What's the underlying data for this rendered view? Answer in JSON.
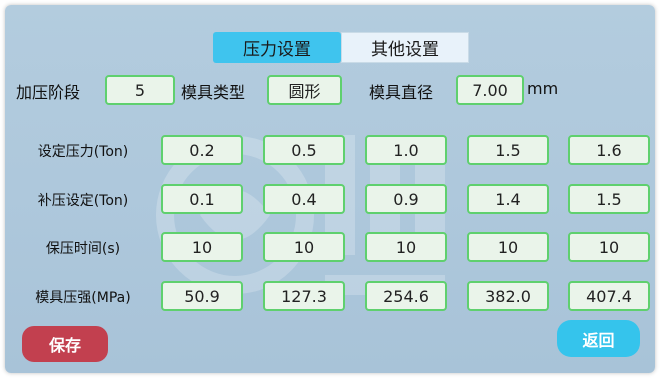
{
  "tabs": [
    {
      "label": "压力设置",
      "active": true
    },
    {
      "label": "其他设置",
      "active": false
    }
  ],
  "top": {
    "stage_label": "加压阶段",
    "stage_value": "5",
    "mold_type_label": "模具类型",
    "mold_type_value": "圆形",
    "diameter_label": "模具直径",
    "diameter_value": "7.00",
    "diameter_unit": "mm"
  },
  "rows": [
    {
      "label": "设定压力(Ton)",
      "values": [
        "0.2",
        "0.5",
        "1.0",
        "1.5",
        "1.6"
      ]
    },
    {
      "label": "补压设定(Ton)",
      "values": [
        "0.1",
        "0.4",
        "0.9",
        "1.4",
        "1.5"
      ]
    },
    {
      "label": "保压时间(s)",
      "values": [
        "10",
        "10",
        "10",
        "10",
        "10"
      ]
    },
    {
      "label": "模具压强(MPa)",
      "values": [
        "50.9",
        "127.3",
        "254.6",
        "382.0",
        "407.4"
      ]
    }
  ],
  "buttons": {
    "save": "保存",
    "back": "返回"
  },
  "colors": {
    "active_tab": "#3fc4ee",
    "save_button": "#c2404f",
    "back_button": "#35c4ec",
    "field_border": "#5fd06e"
  }
}
